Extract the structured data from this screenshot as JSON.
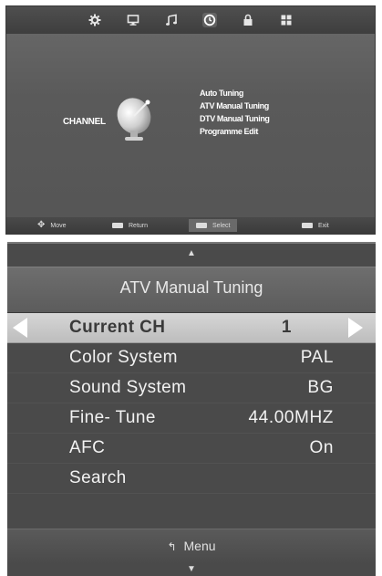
{
  "top_menu": {
    "tabs": [
      {
        "icon": "gear-icon"
      },
      {
        "icon": "monitor-icon"
      },
      {
        "icon": "music-note-icon"
      },
      {
        "icon": "clock-icon"
      },
      {
        "icon": "lock-icon"
      },
      {
        "icon": "grid-icon"
      }
    ],
    "channel_label": "CHANNEL",
    "items": [
      "Auto Tuning",
      "ATV Manual Tuning",
      "DTV Manual Tuning",
      "Programme Edit"
    ],
    "hints": {
      "move": "Move",
      "return": "Return",
      "select": "Select",
      "exit": "Exit"
    }
  },
  "atv": {
    "title": "ATV Manual Tuning",
    "rows": [
      {
        "label": "Current CH",
        "value": "1"
      },
      {
        "label": "Color System",
        "value": "PAL"
      },
      {
        "label": "Sound System",
        "value": "BG"
      },
      {
        "label": "Fine- Tune",
        "value": "44.00MHZ"
      },
      {
        "label": "AFC",
        "value": "On"
      },
      {
        "label": "Search",
        "value": ""
      }
    ],
    "menu_hint": "Menu"
  }
}
